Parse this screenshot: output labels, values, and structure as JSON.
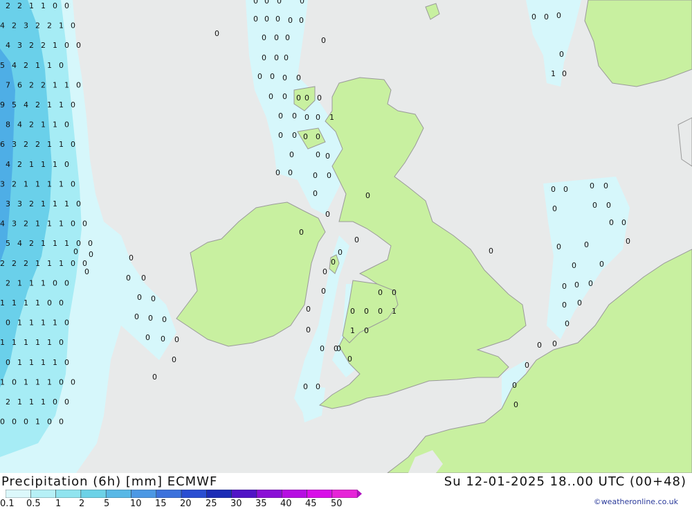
{
  "header": {
    "product": "Precipitation (6h) [mm] ECMWF",
    "valid": "Su 12-01-2025 18..00 UTC (00+48)"
  },
  "legend": {
    "levels": [
      "0.1",
      "0.5",
      "1",
      "2",
      "5",
      "10",
      "15",
      "20",
      "25",
      "30",
      "35",
      "40",
      "45",
      "50"
    ],
    "colors": [
      "#dcf8fb",
      "#b6f0f6",
      "#90e4ef",
      "#6cd2e7",
      "#58b8e6",
      "#4c98e4",
      "#3c72dc",
      "#2a4ed2",
      "#1c2cb6",
      "#5014c6",
      "#8a10d6",
      "#b60ee2",
      "#d80ee8",
      "#e624d8"
    ]
  },
  "map": {
    "colors": {
      "sea": "#e8eaea",
      "land": "#c8f0a0",
      "coast": "#9a9a9a",
      "precip_light": "#d6f7fb",
      "precip_mid": "#a6ecf5",
      "precip_heavy": "#6ad0ea",
      "precip_max": "#4eaee6"
    },
    "ocean_values": [
      [
        "2",
        "2",
        "1",
        "1",
        "0",
        "0"
      ],
      [
        "4",
        "2",
        "3",
        "2",
        "2",
        "1",
        "0"
      ],
      [
        "4",
        "3",
        "2",
        "2",
        "1",
        "0",
        "0"
      ],
      [
        "5",
        "4",
        "2",
        "1",
        "1",
        "0"
      ],
      [
        "7",
        "6",
        "2",
        "2",
        "1",
        "1",
        "0"
      ],
      [
        "9",
        "5",
        "4",
        "2",
        "1",
        "1",
        "0"
      ],
      [
        "8",
        "4",
        "2",
        "1",
        "1",
        "0"
      ],
      [
        "6",
        "3",
        "2",
        "2",
        "1",
        "1",
        "0"
      ],
      [
        "4",
        "2",
        "1",
        "1",
        "1",
        "0"
      ],
      [
        "3",
        "2",
        "1",
        "1",
        "1",
        "1",
        "0"
      ],
      [
        "3",
        "3",
        "2",
        "1",
        "1",
        "1",
        "0"
      ],
      [
        "4",
        "3",
        "2",
        "1",
        "1",
        "1",
        "0",
        "0"
      ],
      [
        "5",
        "4",
        "2",
        "1",
        "1",
        "1",
        "0",
        "0"
      ],
      [
        "2",
        "2",
        "2",
        "1",
        "1",
        "1",
        "0",
        "0"
      ],
      [
        "2",
        "1",
        "1",
        "1",
        "0",
        "0"
      ],
      [
        "1",
        "1",
        "1",
        "1",
        "0",
        "0"
      ],
      [
        "0",
        "1",
        "1",
        "1",
        "1",
        "0"
      ],
      [
        "1",
        "1",
        "1",
        "1",
        "1",
        "0"
      ],
      [
        "0",
        "1",
        "1",
        "1",
        "1",
        "0"
      ],
      [
        "1",
        "0",
        "1",
        "1",
        "1",
        "0",
        "0"
      ],
      [
        "2",
        "1",
        "1",
        "1",
        "0",
        "0"
      ],
      [
        "0",
        "0",
        "0",
        "1",
        "0",
        "0"
      ]
    ],
    "other_values": [
      "0",
      "0",
      "0",
      "0",
      "0",
      "0",
      "0",
      "0",
      "0",
      "0",
      "0",
      "0",
      "0",
      "0",
      "0",
      "0",
      "0",
      "0",
      "0",
      "0",
      "0",
      "0",
      "0",
      "0",
      "0",
      "0",
      "0",
      "0",
      "0",
      "0",
      "1",
      "0",
      "0",
      "0",
      "0",
      "0",
      "0",
      "0",
      "0",
      "0",
      "0",
      "0",
      "0",
      "0",
      "0",
      "0",
      "0",
      "0",
      "0",
      "0",
      "0",
      "0",
      "0",
      "0",
      "0",
      "1",
      "0",
      "0",
      "0",
      "1",
      "0",
      "0",
      "0",
      "0",
      "0",
      "0",
      "0",
      "0",
      "0",
      "0",
      "0",
      "0",
      "0",
      "0",
      "0",
      "0",
      "0",
      "0",
      "0",
      "0",
      "0",
      "0",
      "0",
      "0",
      "0",
      "0",
      "0",
      "0",
      "0",
      "0",
      "0",
      "0",
      "0",
      "0",
      "0",
      "0",
      "0",
      "0",
      "1",
      "0",
      "0"
    ]
  },
  "credit": "©weatheronline.co.uk"
}
